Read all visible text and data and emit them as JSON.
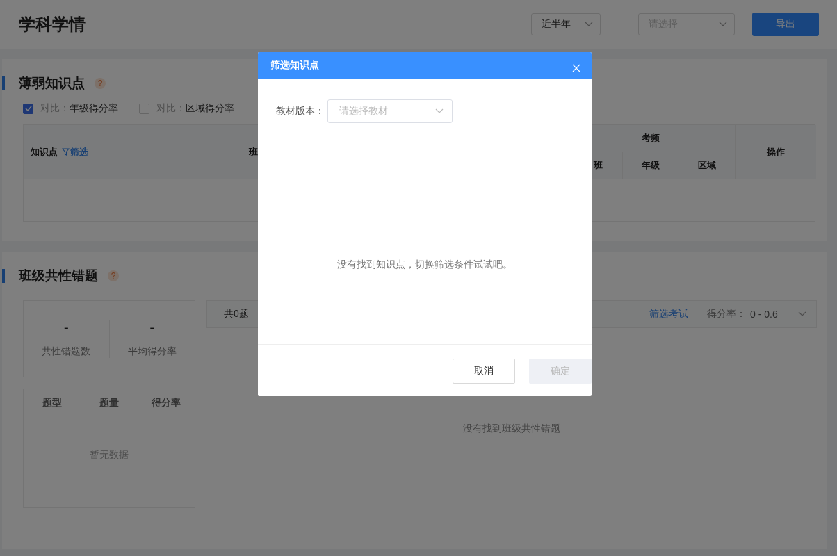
{
  "page_title": "学科学情",
  "toolbar": {
    "period_select": {
      "value": "近半年"
    },
    "class_select": {
      "placeholder": "请选择"
    },
    "export_button": "导出"
  },
  "weak_points": {
    "title": "薄弱知识点",
    "help_icon": "?",
    "compare_options": [
      {
        "prefix": "对比：",
        "label": "年级得分率",
        "checked": true
      },
      {
        "prefix": "对比：",
        "label": "区域得分率",
        "checked": false
      }
    ],
    "table": {
      "column_1": {
        "label": "知识点",
        "filter_link": "筛选"
      },
      "column_2": "班",
      "frequency_group": "考频",
      "frequency_columns": [
        "班",
        "年级",
        "区域"
      ],
      "actions_column": "操作"
    }
  },
  "common_errors": {
    "title": "班级共性错题",
    "help_icon": "?",
    "stats": [
      {
        "value": "-",
        "label": "共性错题数"
      },
      {
        "value": "-",
        "label": "平均得分率"
      }
    ],
    "type_table": {
      "columns": [
        "题型",
        "题量",
        "得分率"
      ],
      "empty_text": "暂无数据"
    },
    "list_header": {
      "count": "共0题",
      "filter_link": "筛选考试",
      "score_filter": {
        "label": "得分率：",
        "value": "0 - 0.6"
      }
    },
    "empty_text": "没有找到班级共性错题"
  },
  "dialog": {
    "title": "筛选知识点",
    "field_label": "教材版本：",
    "field_placeholder": "请选择教材",
    "empty_text": "没有找到知识点，切换筛选条件试试吧。",
    "cancel_button": "取消",
    "confirm_button": {
      "label": "确定",
      "disabled": true
    }
  }
}
